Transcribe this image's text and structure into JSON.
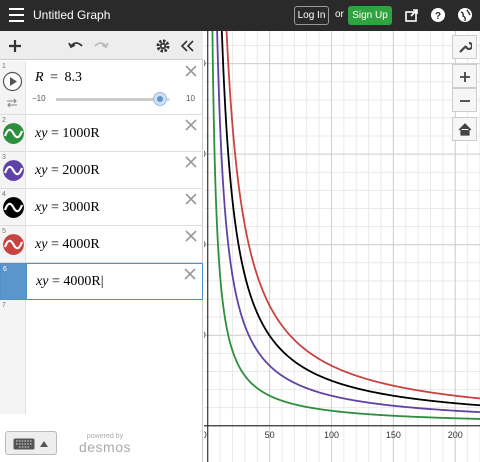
{
  "header": {
    "title": "Untitled Graph",
    "login_label": "Log In",
    "or_label": "or",
    "signup_label": "Sign Up",
    "icons": [
      "menu-icon",
      "share-icon",
      "help-icon",
      "globe-icon"
    ]
  },
  "toolbar": {
    "icons": [
      "add-icon",
      "undo-icon",
      "redo-icon",
      "settings-icon",
      "collapse-icon"
    ]
  },
  "expressions": [
    {
      "num": "1",
      "latex_left": "R",
      "latex_right": "8.3",
      "type": "slider",
      "slider": {
        "min": "−10",
        "max": "10",
        "value": 8.3
      }
    },
    {
      "num": "2",
      "left": "xy",
      "right": "1000R",
      "color": "#2d8e3e"
    },
    {
      "num": "3",
      "left": "xy",
      "right": "2000R",
      "color": "#6042a6"
    },
    {
      "num": "4",
      "left": "xy",
      "right": "3000R",
      "color": "#000000"
    },
    {
      "num": "5",
      "left": "xy",
      "right": "4000R",
      "color": "#c74440"
    },
    {
      "num": "6",
      "left": "xy",
      "right": "4000R",
      "selected": true
    },
    {
      "num": "7"
    }
  ],
  "footer": {
    "powered_by": "powered by",
    "brand": "desmos"
  },
  "graph": {
    "x_ticks": [
      "0",
      "50",
      "100",
      "150",
      "200"
    ],
    "y_ticks": [
      "2000",
      "1500",
      "1000",
      "500"
    ],
    "side_icons": [
      "wrench-icon",
      "zoom-in-icon",
      "zoom-out-icon",
      "home-icon"
    ]
  },
  "chart_data": {
    "type": "line",
    "xlim": [
      -3,
      220
    ],
    "ylim": [
      -200,
      2180
    ],
    "series": [
      {
        "k": 8300,
        "color": "#2d8e3e"
      },
      {
        "k": 16600,
        "color": "#6042a6"
      },
      {
        "k": 24900,
        "color": "#000000"
      },
      {
        "k": 33200,
        "color": "#c74440"
      }
    ]
  }
}
